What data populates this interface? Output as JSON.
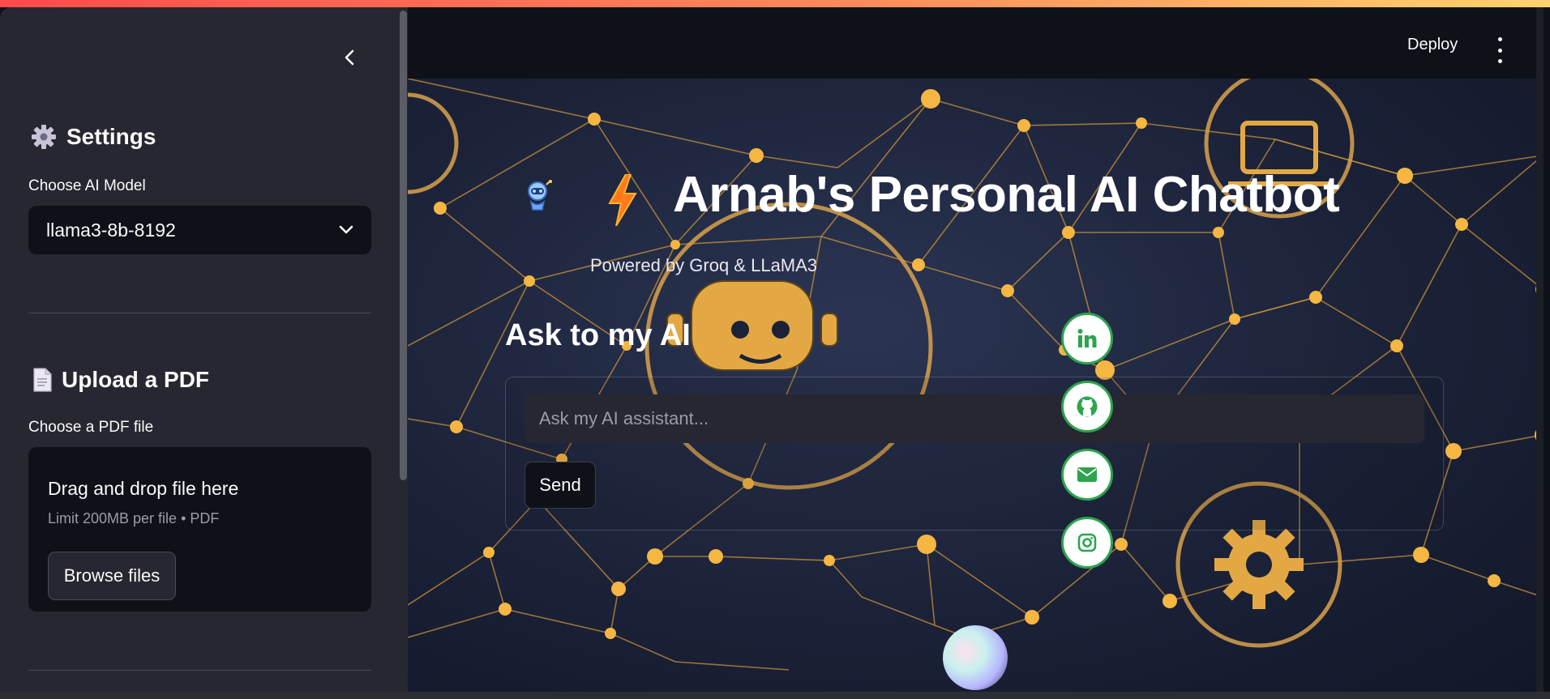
{
  "sidebar": {
    "settings_heading": "Settings",
    "model_label": "Choose AI Model",
    "model_selected": "llama3-8b-8192",
    "upload_heading": "Upload a PDF",
    "file_label": "Choose a PDF file",
    "dropzone_title": "Drag and drop file here",
    "dropzone_limit": "Limit 200MB per file • PDF",
    "browse_label": "Browse files"
  },
  "header": {
    "deploy_label": "Deploy"
  },
  "main": {
    "title": "Arnab's Personal AI Chatbot",
    "subtitle": "Powered by Groq & LLaMA3",
    "ask_heading": "Ask to my AI",
    "input_placeholder": "Ask my AI assistant...",
    "send_label": "Send"
  },
  "social": [
    "linkedin",
    "github",
    "email",
    "instagram"
  ],
  "colors": {
    "accent_start": "#ff4b4b",
    "accent_end": "#ffd36e",
    "social_border": "#2ea44f",
    "network_gold": "#f5b642",
    "sidebar_bg": "#262730",
    "app_bg": "#0e1117"
  }
}
